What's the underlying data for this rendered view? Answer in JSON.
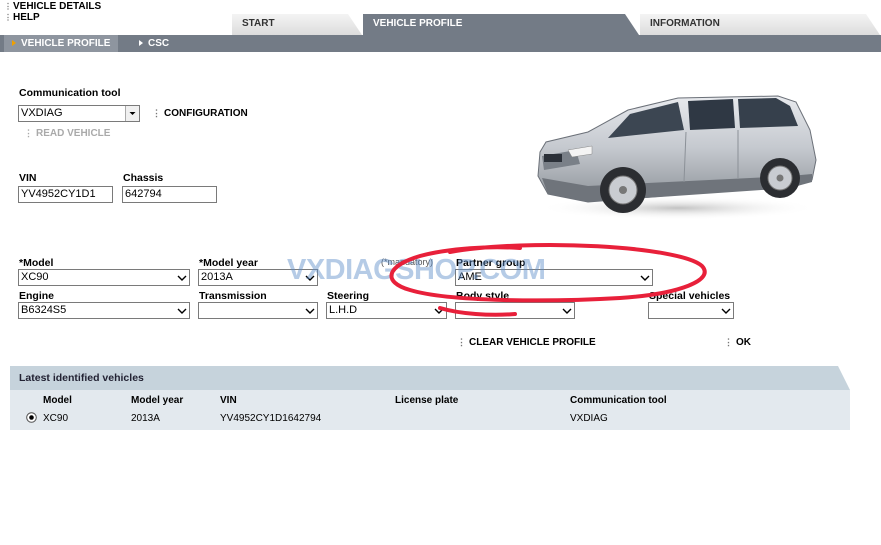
{
  "menu": {
    "item1": "VEHICLE DETAILS",
    "item2": "HELP"
  },
  "tabs": {
    "start": "START",
    "vehicle_profile": "VEHICLE PROFILE",
    "information": "INFORMATION"
  },
  "subtabs": {
    "vehicle_profile": "VEHICLE PROFILE",
    "csc": "CSC"
  },
  "form": {
    "comm_tool_label": "Communication tool",
    "comm_tool_value": "VXDIAG",
    "configuration": "CONFIGURATION",
    "read_vehicle": "READ VEHICLE",
    "vin_label": "VIN",
    "vin_value": "YV4952CY1D1",
    "chassis_label": "Chassis",
    "chassis_value": "642794",
    "mandatory": "(*mandatory)",
    "model_label": "*Model",
    "model_value": "XC90",
    "model_year_label": "*Model year",
    "model_year_value": "2013A",
    "partner_group_label": "Partner group",
    "partner_group_value": "AME",
    "engine_label": "Engine",
    "engine_value": "B6324S5",
    "transmission_label": "Transmission",
    "transmission_value": "",
    "steering_label": "Steering",
    "steering_value": "L.H.D",
    "body_style_label": "Body style",
    "special_vehicles_label": "Special vehicles",
    "clear_profile": "CLEAR VEHICLE PROFILE",
    "ok": "OK"
  },
  "watermark": "VXDIAGSHOP.COM",
  "latest": {
    "title": "Latest identified vehicles",
    "columns": [
      "Model",
      "Model year",
      "VIN",
      "License plate",
      "Communication tool"
    ],
    "rows": [
      {
        "model": "XC90",
        "model_year": "2013A",
        "vin": "YV4952CY1D1642794",
        "license_plate": "",
        "comm_tool": "VXDIAG"
      }
    ]
  },
  "colors": {
    "tab_active": "#737b86",
    "panel_head": "#c6d3dc",
    "panel_body": "#e3e9ee",
    "annotation": "#e8203a"
  }
}
